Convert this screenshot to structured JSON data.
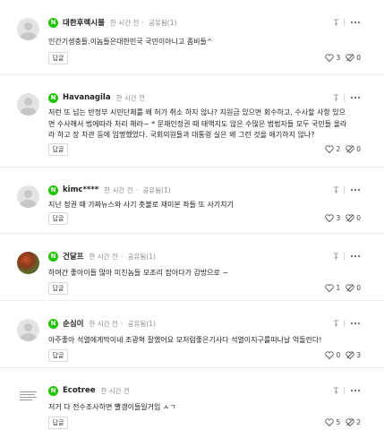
{
  "comments": [
    {
      "nick": "대한후렉시불",
      "time": "한 시간 전",
      "sympathy": "공유됨(1)",
      "text": "인간기생충들.이놈들은대한민국 국민이아니고 좀비들^",
      "reply": "답글",
      "likes": "3",
      "dislikes": "0"
    },
    {
      "nick": "Havanagila",
      "time": "한 시간 전",
      "sympathy": "",
      "text": "저런 또 넘는 반정부 시민단체를 왜 허가 취소 하지 않나? 지원금 있으면 회수하고, 수사할 사항 있으면 수사해서 법에따라 처리 해라~ * 문재인정권 때 태액지도 않은 수많은 범법자들 모두 국민들 올라라 하고 장 차관 등에 임명했었다. 국회의원들과 대통령 실은 왜 그런 것을 애기하지 않나?",
      "reply": "답글",
      "likes": "2",
      "dislikes": "0"
    },
    {
      "nick": "kimc****",
      "time": "한 시간 전",
      "sympathy": "공유됨(1)",
      "text": "지난 정권 때 가짜뉴스와 사기 촛불로 재미본 좌들 또 사기치기",
      "reply": "답글",
      "likes": "3",
      "dislikes": "0"
    },
    {
      "nick": "건달프",
      "time": "한 시간 전",
      "sympathy": "공유됨(1)",
      "text": "하여간 좋아이들 많아 미친놈들 모조리 잡아다가 감방으로 ~",
      "reply": "답글",
      "likes": "1",
      "dislikes": "0"
    },
    {
      "nick": "순심이",
      "time": "한 시간 전",
      "sympathy": "공유됨(1)",
      "text": "아주좋아 석열에게막이네 조광혁 잘했어요 모처럼좋은기사다 석열이지구를떠나날 억돌린다!",
      "reply": "답글",
      "likes": "0",
      "dislikes": "3"
    },
    {
      "nick": "Ecotree",
      "time": "한 시간 전",
      "sympathy": "",
      "text": "저거 다 전수조사하면 빨갱이들일거임 ㅅㄱ",
      "reply": "답글",
      "likes": "5",
      "dislikes": "2"
    }
  ],
  "icons": {
    "badge": "N",
    "reply_text": "답글"
  },
  "colors": {
    "badge": "#1ec800",
    "meta": "#8a8a8a",
    "border": "#ececec"
  }
}
